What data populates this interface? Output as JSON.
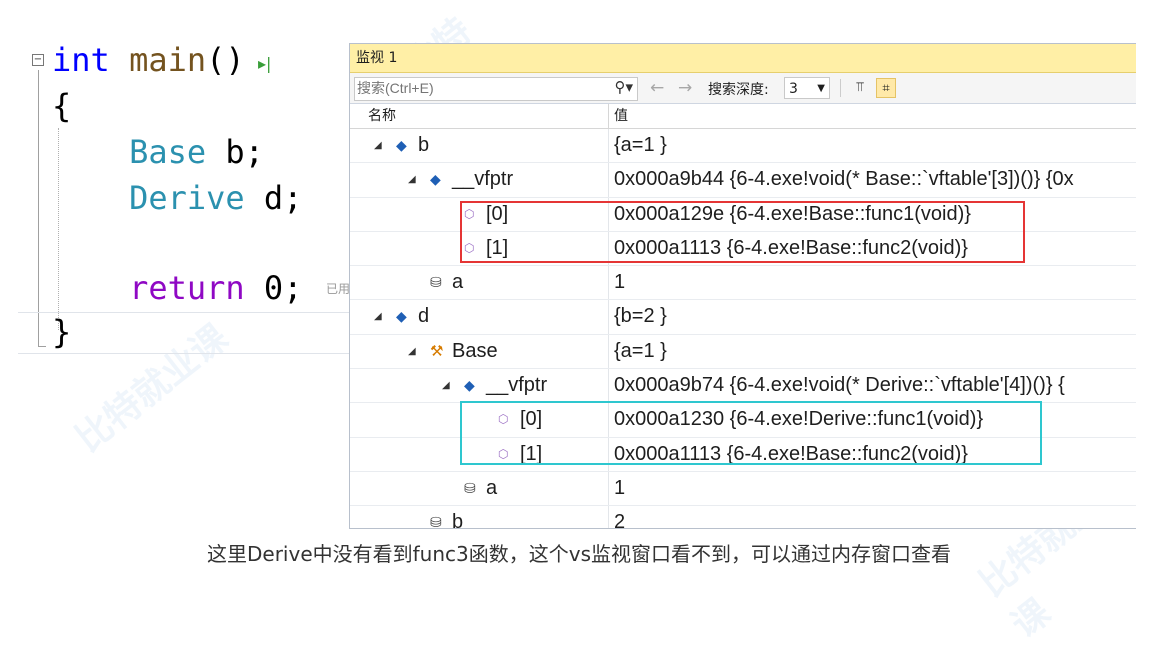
{
  "editor": {
    "lines": [
      {
        "parts": [
          {
            "t": "int",
            "c": "kw"
          },
          {
            "t": " ",
            "c": ""
          },
          {
            "t": "main",
            "c": "fn"
          },
          {
            "t": "()",
            "c": ""
          }
        ]
      },
      {
        "parts": [
          {
            "t": "{",
            "c": ""
          }
        ]
      },
      {
        "parts": [
          {
            "t": "    ",
            "c": ""
          },
          {
            "t": "Base",
            "c": "type"
          },
          {
            "t": " b;",
            "c": ""
          }
        ]
      },
      {
        "parts": [
          {
            "t": "    ",
            "c": ""
          },
          {
            "t": "Derive",
            "c": "type"
          },
          {
            "t": " d;",
            "c": ""
          }
        ]
      },
      {
        "parts": [
          {
            "t": "",
            "c": ""
          }
        ]
      },
      {
        "parts": [
          {
            "t": "    ",
            "c": ""
          },
          {
            "t": "return",
            "c": "kw2"
          },
          {
            "t": " 0;",
            "c": ""
          }
        ]
      },
      {
        "parts": [
          {
            "t": "}",
            "c": ""
          }
        ]
      }
    ],
    "elapsed_hint": "已用"
  },
  "watch": {
    "title": "监视 1",
    "search_placeholder": "搜索(Ctrl+E)",
    "depth_label": "搜索深度:",
    "depth_value": "3",
    "col_name": "名称",
    "col_value": "值",
    "rows": [
      {
        "name": "b",
        "value": "{a=1 }",
        "indent": 0,
        "expander": "expanded",
        "icon": "object-icon"
      },
      {
        "name": "__vfptr",
        "value": "0x000a9b44 {6-4.exe!void(* Base::`vftable'[3])()} {0x",
        "indent": 1,
        "expander": "expanded",
        "icon": "object-icon"
      },
      {
        "name": "[0]",
        "value": "0x000a129e {6-4.exe!Base::func1(void)}",
        "indent": 2,
        "expander": "none",
        "icon": "vtable-entry-icon"
      },
      {
        "name": "[1]",
        "value": "0x000a1113 {6-4.exe!Base::func2(void)}",
        "indent": 2,
        "expander": "none",
        "icon": "vtable-entry-icon"
      },
      {
        "name": "a",
        "value": "1",
        "indent": 1,
        "expander": "none",
        "icon": "field-icon"
      },
      {
        "name": "d",
        "value": "{b=2 }",
        "indent": 0,
        "expander": "expanded",
        "icon": "object-icon"
      },
      {
        "name": "Base",
        "value": "{a=1 }",
        "indent": 1,
        "expander": "expanded",
        "icon": "base-class-icon"
      },
      {
        "name": "__vfptr",
        "value": "0x000a9b74 {6-4.exe!void(* Derive::`vftable'[4])()} {",
        "indent": 2,
        "expander": "expanded",
        "icon": "object-icon"
      },
      {
        "name": "[0]",
        "value": "0x000a1230 {6-4.exe!Derive::func1(void)}",
        "indent": 3,
        "expander": "none",
        "icon": "vtable-entry-icon"
      },
      {
        "name": "[1]",
        "value": "0x000a1113 {6-4.exe!Base::func2(void)}",
        "indent": 3,
        "expander": "none",
        "icon": "vtable-entry-icon"
      },
      {
        "name": "a",
        "value": "1",
        "indent": 2,
        "expander": "none",
        "icon": "field-icon"
      },
      {
        "name": "b",
        "value": "2",
        "indent": 1,
        "expander": "none",
        "icon": "field-icon"
      }
    ]
  },
  "caption": "这里Derive中没有看到func3函数，这个vs监视窗口看不到，可以通过内存窗口查看",
  "colors": {
    "highlight_red": "#e53535",
    "highlight_cyan": "#2ec7cf",
    "title_bar": "#ffefa6"
  }
}
